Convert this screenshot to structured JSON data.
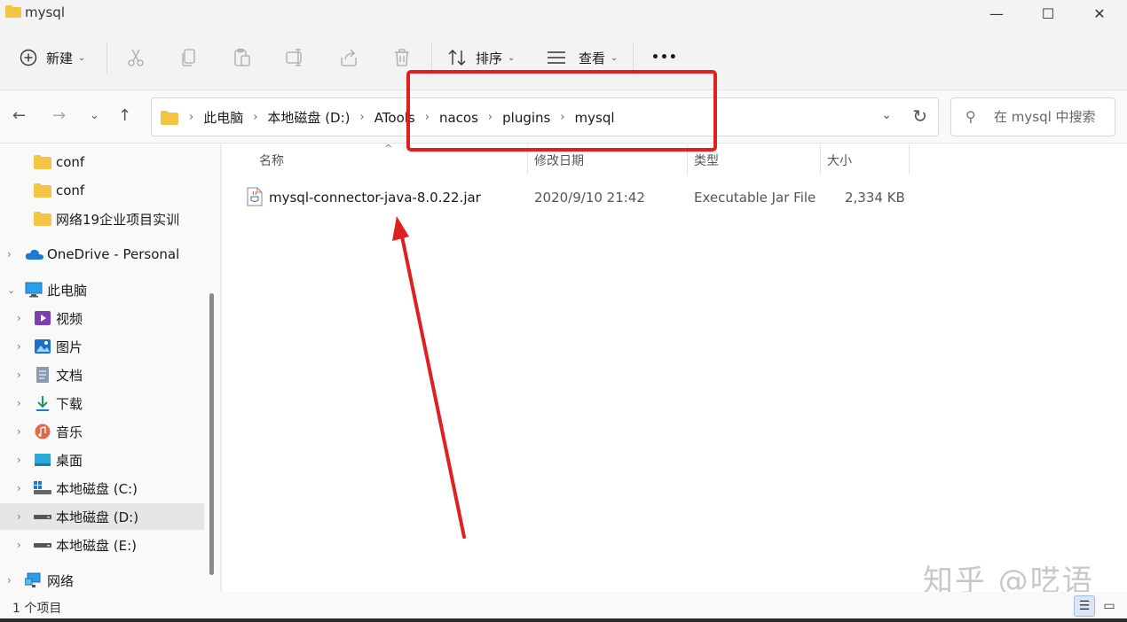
{
  "window": {
    "title": "mysql",
    "minimize_label": "—",
    "maximize_label": "☐",
    "close_label": "✕"
  },
  "toolbar": {
    "new_label": "新建",
    "sort_label": "排序",
    "view_label": "查看",
    "more_label": "•••"
  },
  "address": {
    "breadcrumbs": [
      "此电脑",
      "本地磁盘 (D:)",
      "ATools",
      "nacos",
      "plugins",
      "mysql"
    ]
  },
  "search": {
    "placeholder": "在 mysql 中搜索"
  },
  "sidebar": {
    "items": [
      {
        "label": "conf",
        "icon": "folder-icon"
      },
      {
        "label": "conf",
        "icon": "folder-icon"
      },
      {
        "label": "网络19企业项目实训",
        "icon": "folder-icon"
      },
      {
        "label": "OneDrive - Personal",
        "icon": "cloud-icon"
      },
      {
        "label": "此电脑",
        "icon": "computer-icon"
      },
      {
        "label": "视频",
        "icon": "video-icon"
      },
      {
        "label": "图片",
        "icon": "picture-icon"
      },
      {
        "label": "文档",
        "icon": "document-icon"
      },
      {
        "label": "下载",
        "icon": "download-icon"
      },
      {
        "label": "音乐",
        "icon": "music-icon"
      },
      {
        "label": "桌面",
        "icon": "desktop-icon"
      },
      {
        "label": "本地磁盘 (C:)",
        "icon": "drive-icon"
      },
      {
        "label": "本地磁盘 (D:)",
        "icon": "drive-icon"
      },
      {
        "label": "本地磁盘 (E:)",
        "icon": "drive-icon"
      },
      {
        "label": "网络",
        "icon": "network-icon"
      }
    ]
  },
  "columns": {
    "name": "名称",
    "modified": "修改日期",
    "type": "类型",
    "size": "大小"
  },
  "files": [
    {
      "name": "mysql-connector-java-8.0.22.jar",
      "modified": "2020/9/10 21:42",
      "type": "Executable Jar File",
      "size": "2,334 KB"
    }
  ],
  "status": {
    "item_count": "1 个项目"
  },
  "watermark": "知乎 @呓语",
  "colors": {
    "annotation": "#e02020",
    "folder": "#f4c542",
    "selection": "#e6e6e6"
  }
}
